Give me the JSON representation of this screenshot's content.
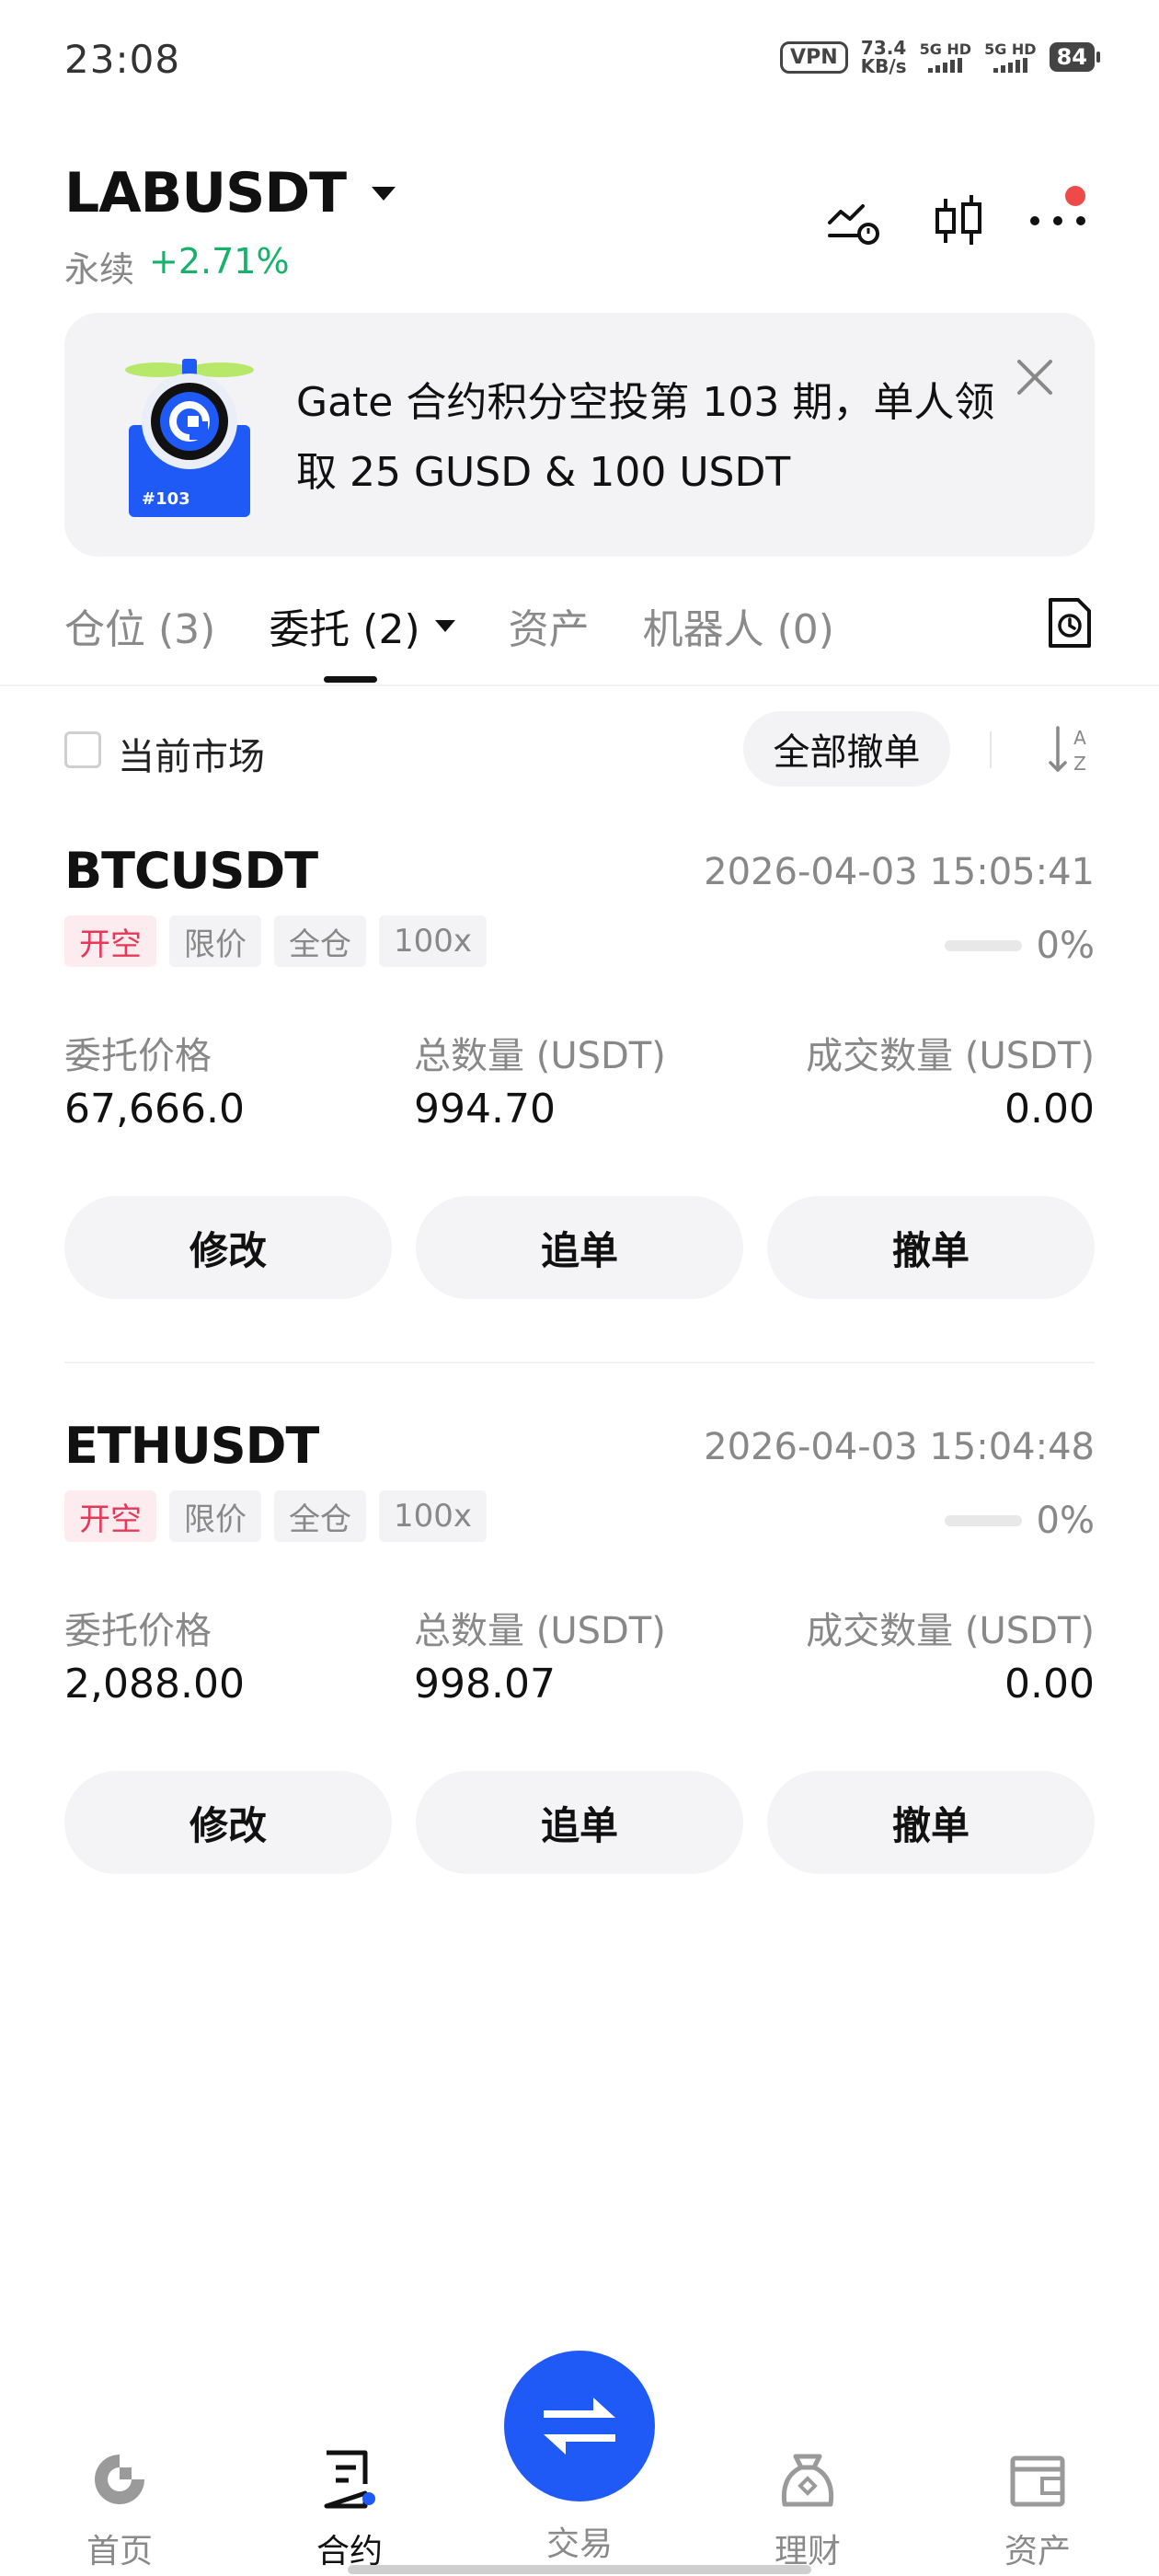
{
  "status_bar": {
    "time": "23:08",
    "vpn": "VPN",
    "net_speed_value": "73.4",
    "net_speed_unit": "KB/s",
    "sim1_label": "5G HD",
    "sim2_label": "5G HD",
    "battery": "84"
  },
  "header": {
    "pair": "LABUSDT",
    "contract_type": "永续",
    "change": "+2.71%"
  },
  "banner": {
    "badge": "#103",
    "text": "Gate 合约积分空投第 103 期，单人领取 25 GUSD & 100 USDT"
  },
  "tabs": [
    {
      "label": "仓位 (3)"
    },
    {
      "label": "委托 (2)"
    },
    {
      "label": "资产"
    },
    {
      "label": "机器人 (0)"
    }
  ],
  "filter": {
    "current_market_label": "当前市场",
    "cancel_all_label": "全部撤单"
  },
  "orders": [
    {
      "symbol": "BTCUSDT",
      "time": "2026-04-03 15:05:41",
      "tags": [
        "开空",
        "限价",
        "全仓",
        "100x"
      ],
      "filled_percent_label": "0%",
      "filled_fraction": 0,
      "price_label": "委托价格",
      "price": "67,666.0",
      "total_label": "总数量 (USDT)",
      "total": "994.70",
      "filled_label": "成交数量 (USDT)",
      "filled": "0.00",
      "buttons": [
        "修改",
        "追单",
        "撤单"
      ]
    },
    {
      "symbol": "ETHUSDT",
      "time": "2026-04-03 15:04:48",
      "tags": [
        "开空",
        "限价",
        "全仓",
        "100x"
      ],
      "filled_percent_label": "0%",
      "filled_fraction": 0,
      "price_label": "委托价格",
      "price": "2,088.00",
      "total_label": "总数量 (USDT)",
      "total": "998.07",
      "filled_label": "成交数量 (USDT)",
      "filled": "0.00",
      "buttons": [
        "修改",
        "追单",
        "撤单"
      ]
    }
  ],
  "bottom_nav": [
    {
      "label": "首页",
      "icon": "home-icon"
    },
    {
      "label": "合约",
      "icon": "futures-icon"
    },
    {
      "label": "交易",
      "icon": "swap-icon"
    },
    {
      "label": "理财",
      "icon": "earn-icon"
    },
    {
      "label": "资产",
      "icon": "wallet-icon"
    }
  ],
  "colors": {
    "accent_blue": "#1f5af6",
    "positive_green": "#17b26a",
    "short_red": "#e5395a",
    "notification_red": "#ef4a4a"
  }
}
